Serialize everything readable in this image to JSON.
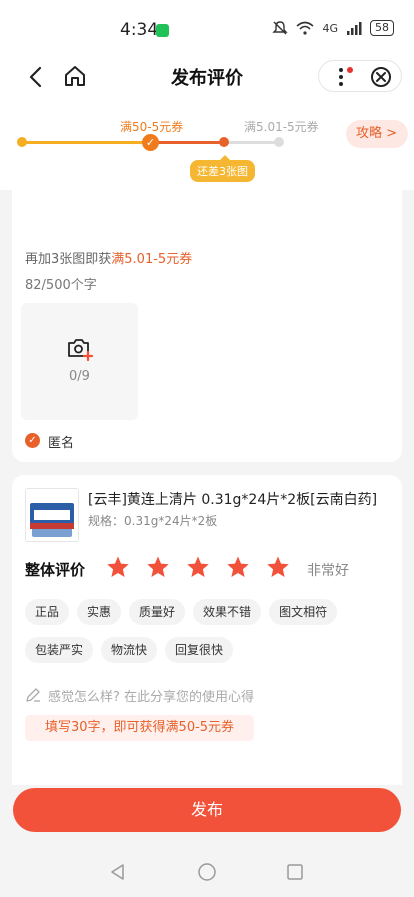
{
  "status_bar": {
    "time": "4:34",
    "network": "4G",
    "battery": "58"
  },
  "nav": {
    "title": "发布评价"
  },
  "progress": {
    "label_current": "满50-5元券",
    "label_next": "满5.01-5元券",
    "tip": "还差3张图",
    "guide_label": "攻略 >"
  },
  "review": {
    "hint_prefix": "再加3张图即获",
    "hint_highlight": "满5.01-5元券",
    "char_count": "82/500个字",
    "upload_count": "0/9",
    "anonymous_label": "匿名"
  },
  "product": {
    "title": "[云丰]黄连上清片 0.31g*24片*2板[云南白药]",
    "spec": "规格：0.31g*24片*2板"
  },
  "rating": {
    "label": "整体评价",
    "stars": 5,
    "max_stars": 5,
    "text": "非常好",
    "star_color": "#f2513a"
  },
  "tags": [
    "正品",
    "实惠",
    "质量好",
    "效果不错",
    "图文相符",
    "包装严实",
    "物流快",
    "回复很快"
  ],
  "comment": {
    "placeholder": "感觉怎么样? 在此分享您的使用心得",
    "reward_tip": "填写30字，即可获得满50-5元券"
  },
  "publish_label": "发布",
  "colors": {
    "accent": "#f2513a",
    "progress_orange": "#f07b1c",
    "tip_yellow": "#f5b731"
  }
}
